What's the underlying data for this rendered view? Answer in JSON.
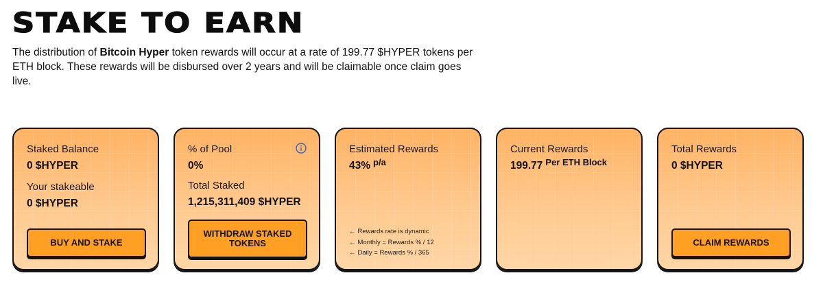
{
  "page": {
    "title": "STAKE TO EARN",
    "intro_before": "The distribution of ",
    "intro_bold": "Bitcoin Hyper",
    "intro_after": " token rewards will occur at a rate of 199.77 $HYPER tokens per ETH block. These rewards will be disbursed over 2 years and will be claimable once claim goes live."
  },
  "cards": {
    "staked": {
      "balance_label": "Staked Balance",
      "balance_value": "0 $HYPER",
      "stakeable_label": "Your stakeable",
      "stakeable_value": "0 $HYPER",
      "button": "BUY AND STAKE"
    },
    "pool": {
      "pool_label": "% of Pool",
      "pool_value": "0%",
      "total_label": "Total Staked",
      "total_value": "1,215,311,409 $HYPER",
      "button": "WITHDRAW STAKED TOKENS",
      "info_icon": "info-icon"
    },
    "estimated": {
      "label": "Estimated Rewards",
      "value": "43%",
      "unit": "p/a",
      "notes": [
        "Rewards rate is dynamic",
        "Monthly = Rewards % / 12",
        "Daily = Rewards % / 365"
      ],
      "note_arrow": "←"
    },
    "current": {
      "label": "Current Rewards",
      "value": "199.77",
      "unit": "Per ETH Block"
    },
    "total": {
      "label": "Total Rewards",
      "value": "0 $HYPER",
      "button": "CLAIM REWARDS"
    }
  },
  "colors": {
    "card_top": "#ffb364",
    "card_bottom": "#ffd6a6",
    "button": "#ff9f23",
    "border": "#141414",
    "info_icon": "#2f66c9"
  }
}
